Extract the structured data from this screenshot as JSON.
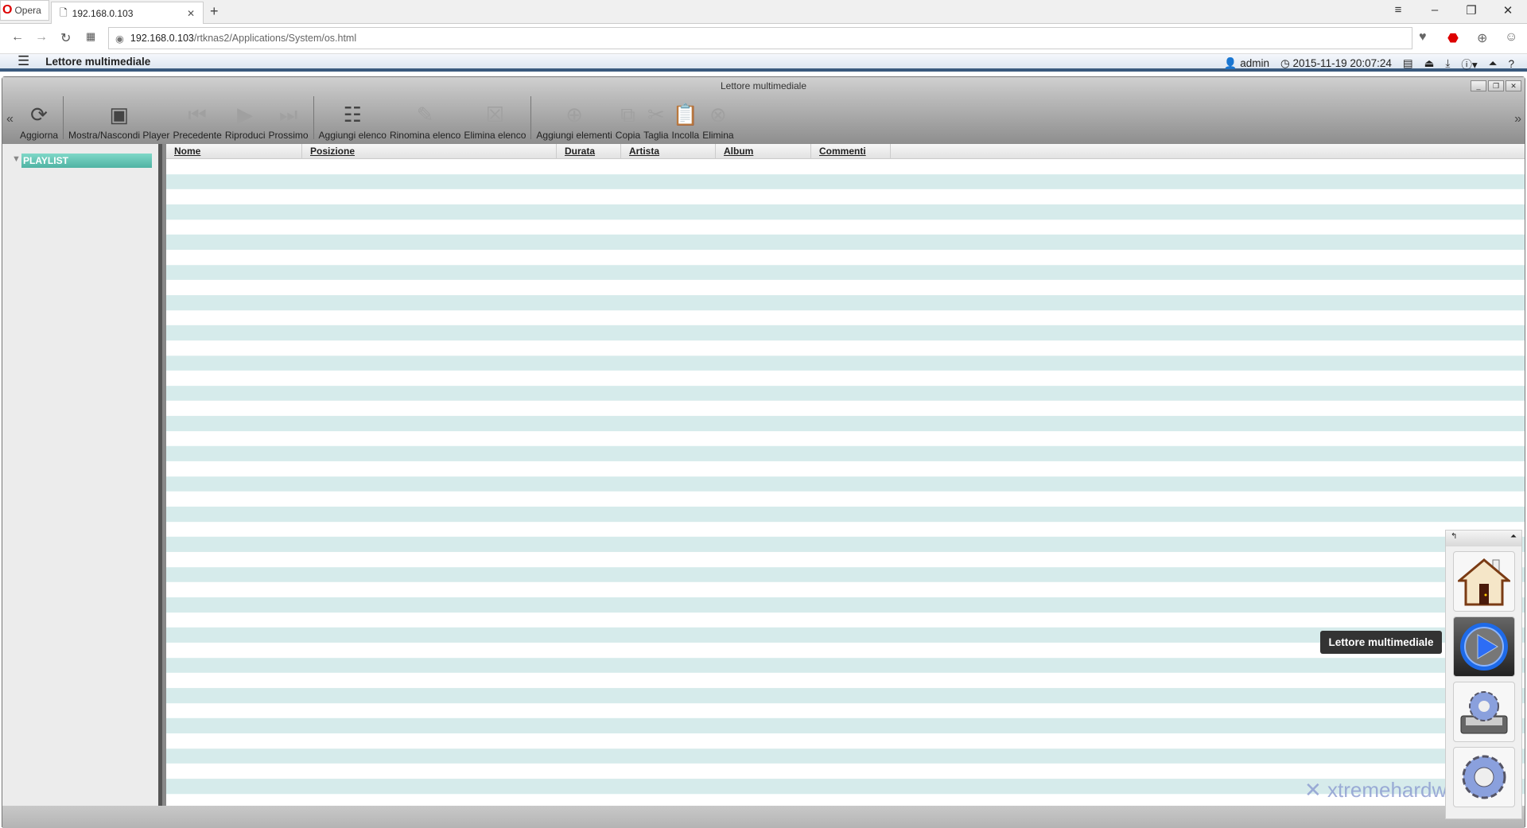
{
  "browser": {
    "brand": "Opera",
    "tab_title": "192.168.0.103",
    "url_host": "192.168.0.103",
    "url_path": "/rtknas2/Applications/System/os.html"
  },
  "app": {
    "title": "Lettore multimediale",
    "user": "admin",
    "datetime": "2015-11-19 20:07:24"
  },
  "window": {
    "title": "Lettore multimediale"
  },
  "toolbar": [
    {
      "label": "Aggiorna",
      "icon": "refresh-icon",
      "enabled": true
    },
    {
      "label": "Mostra/Nascondi Player",
      "icon": "player-icon",
      "enabled": true
    },
    {
      "label": "Precedente",
      "icon": "previous-icon",
      "enabled": false
    },
    {
      "label": "Riproduci",
      "icon": "play-icon",
      "enabled": false
    },
    {
      "label": "Prossimo",
      "icon": "next-icon",
      "enabled": false
    },
    {
      "label": "Aggiungi elenco",
      "icon": "add-list-icon",
      "enabled": true
    },
    {
      "label": "Rinomina elenco",
      "icon": "rename-list-icon",
      "enabled": false
    },
    {
      "label": "Elimina elenco",
      "icon": "delete-list-icon",
      "enabled": false
    },
    {
      "label": "Aggiungi elementi",
      "icon": "add-items-icon",
      "enabled": false
    },
    {
      "label": "Copia",
      "icon": "copy-icon",
      "enabled": false
    },
    {
      "label": "Taglia",
      "icon": "cut-icon",
      "enabled": false
    },
    {
      "label": "Incolla",
      "icon": "paste-icon",
      "enabled": false
    },
    {
      "label": "Elimina",
      "icon": "delete-icon",
      "enabled": false
    }
  ],
  "tree": {
    "root": "PLAYLIST"
  },
  "columns": [
    "Nome",
    "Posizione",
    "Durata",
    "Artista",
    "Album",
    "Commenti"
  ],
  "dock": {
    "tooltip": "Lettore multimediale",
    "items": [
      "home-icon",
      "media-player-icon",
      "storage-settings-icon",
      "settings-icon"
    ]
  },
  "watermark": "xtremehardware.com",
  "colors": {
    "stripe": "#d6ebeb",
    "selection": "#5cc0b0",
    "appbar_border": "#3a5a7e"
  }
}
